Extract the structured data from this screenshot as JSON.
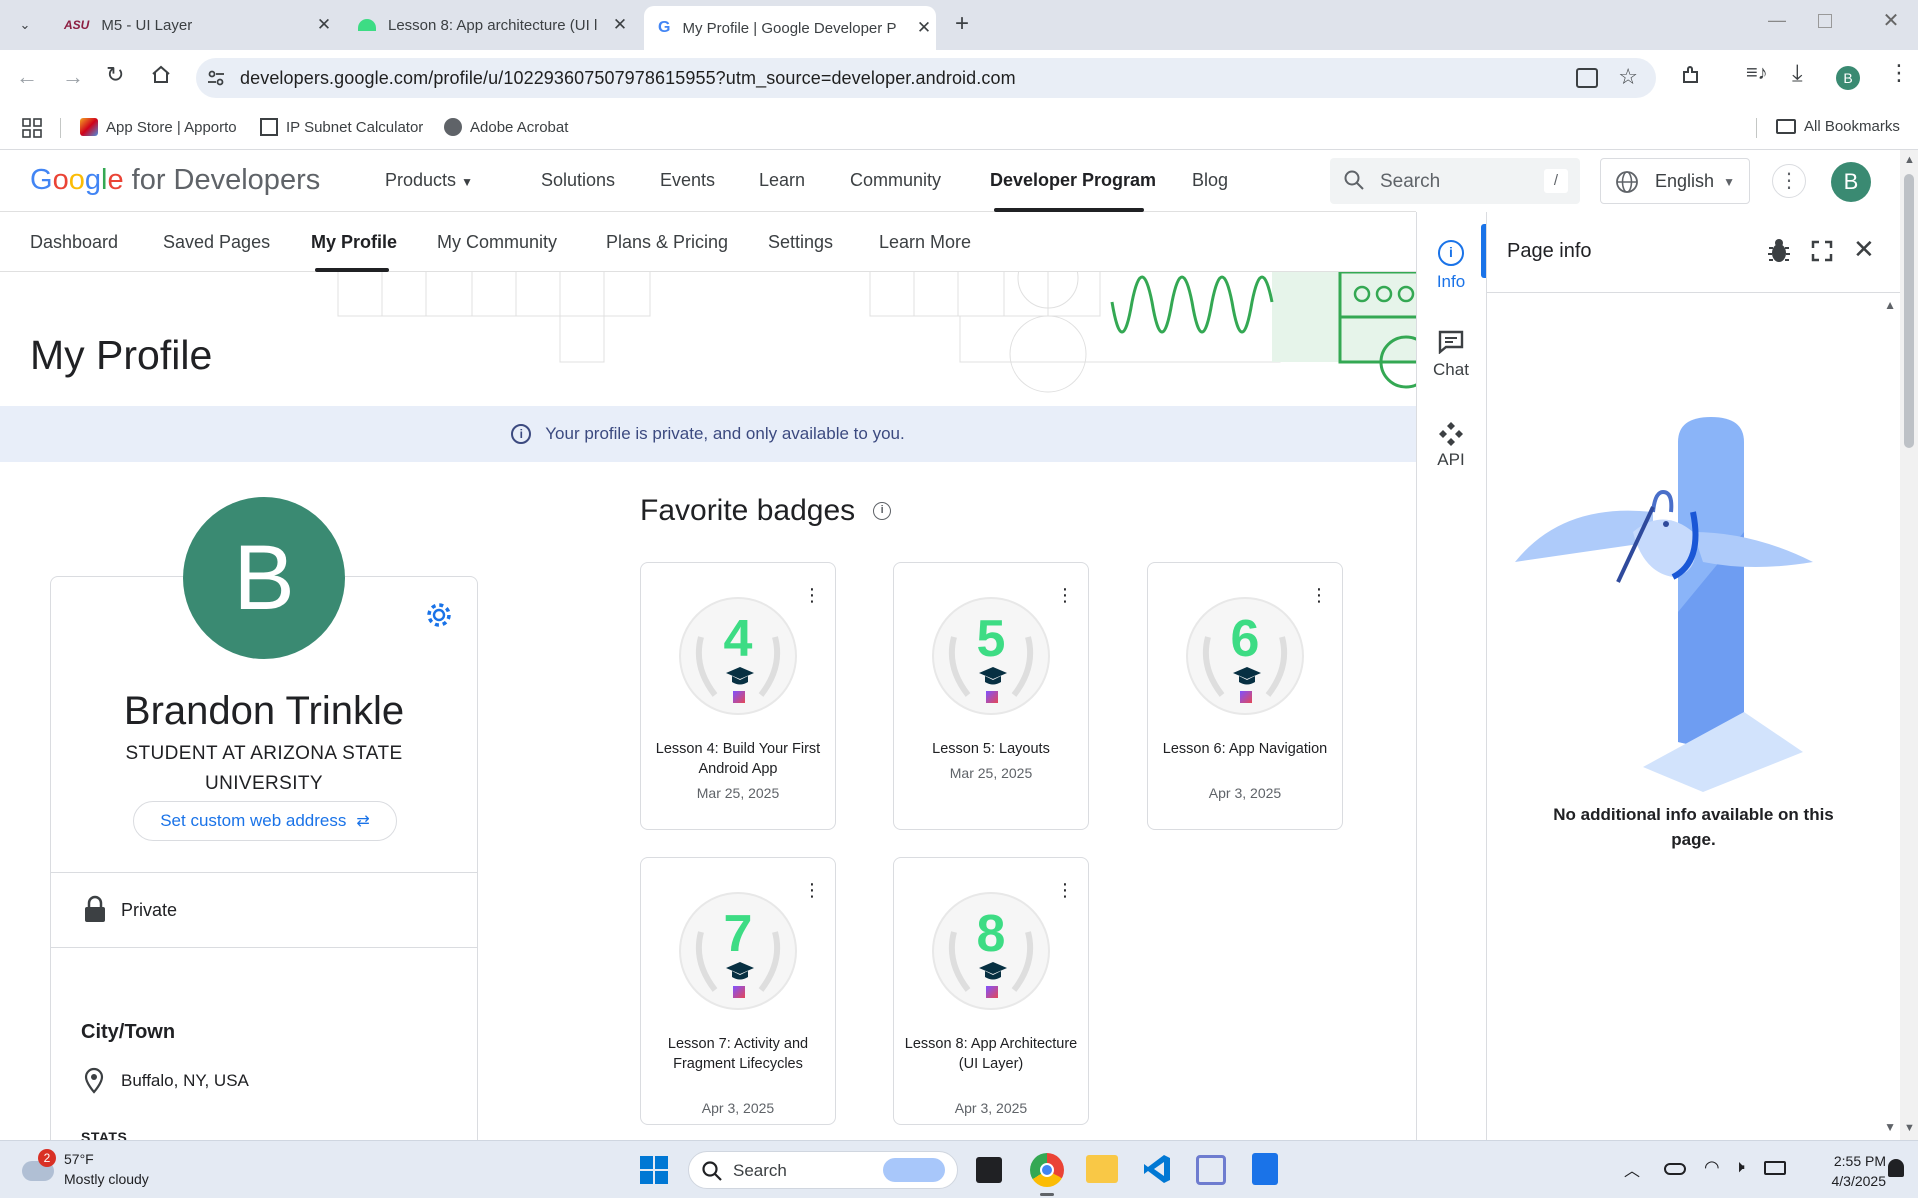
{
  "browser": {
    "tabs": [
      {
        "title": "M5 - UI Layer",
        "favicon": "asu-icon"
      },
      {
        "title": "Lesson 8: App architecture (UI l",
        "favicon": "android-icon"
      },
      {
        "title": "My Profile | Google Developer P",
        "favicon": "google-icon",
        "active": true
      }
    ],
    "url": "developers.google.com/profile/u/102293607507978615955?utm_source=developer.android.com",
    "profile_initial": "B",
    "bookmarks": [
      {
        "label": "App Store | Apporto"
      },
      {
        "label": "IP Subnet Calculator"
      },
      {
        "label": "Adobe Acrobat"
      }
    ],
    "all_bookmarks": "All Bookmarks"
  },
  "site": {
    "logo_google": "Google",
    "logo_suffix": "for Developers",
    "nav": [
      "Products",
      "Solutions",
      "Events",
      "Learn",
      "Community",
      "Developer Program",
      "Blog"
    ],
    "active_nav": "Developer Program",
    "search_placeholder": "Search",
    "search_shortcut": "/",
    "language": "English",
    "avatar_initial": "B",
    "subnav": [
      "Dashboard",
      "Saved Pages",
      "My Profile",
      "My Community",
      "Plans & Pricing",
      "Settings",
      "Learn More"
    ],
    "active_subnav": "My Profile"
  },
  "profile": {
    "page_title": "My Profile",
    "privacy_notice": "Your profile is private, and only available to you.",
    "avatar_letter": "B",
    "name": "Brandon Trinkle",
    "headline_1": "STUDENT AT ARIZONA STATE",
    "headline_2": "UNIVERSITY",
    "custom_url_button": "Set custom web address",
    "visibility": "Private",
    "city_heading": "City/Town",
    "city": "Buffalo, NY, USA",
    "stats_heading": "STATS"
  },
  "badges": {
    "heading": "Favorite badges",
    "items": [
      {
        "number": "4",
        "title": "Lesson 4: Build Your First Android App",
        "date": "Mar 25, 2025"
      },
      {
        "number": "5",
        "title": "Lesson 5: Layouts",
        "date": "Mar 25, 2025"
      },
      {
        "number": "6",
        "title": "Lesson 6: App Navigation",
        "date": "Apr 3, 2025"
      },
      {
        "number": "7",
        "title": "Lesson 7: Activity and Fragment Lifecycles",
        "date": "Apr 3, 2025"
      },
      {
        "number": "8",
        "title": "Lesson 8: App Architecture (UI Layer)",
        "date": "Apr 3, 2025"
      }
    ]
  },
  "side_panel": {
    "tabs": [
      "Info",
      "Chat",
      "API"
    ],
    "title": "Page info",
    "empty_message": "No additional info available on this page."
  },
  "taskbar": {
    "weather_temp": "57°F",
    "weather_desc": "Mostly cloudy",
    "weather_badge": "2",
    "search_label": "Search",
    "time": "2:55 PM",
    "date": "4/3/2025"
  },
  "colors": {
    "accent_blue": "#1a73e8",
    "avatar_green": "#3a8a72",
    "badge_green": "#3ddc84",
    "banner_bg": "#e8eef9"
  }
}
